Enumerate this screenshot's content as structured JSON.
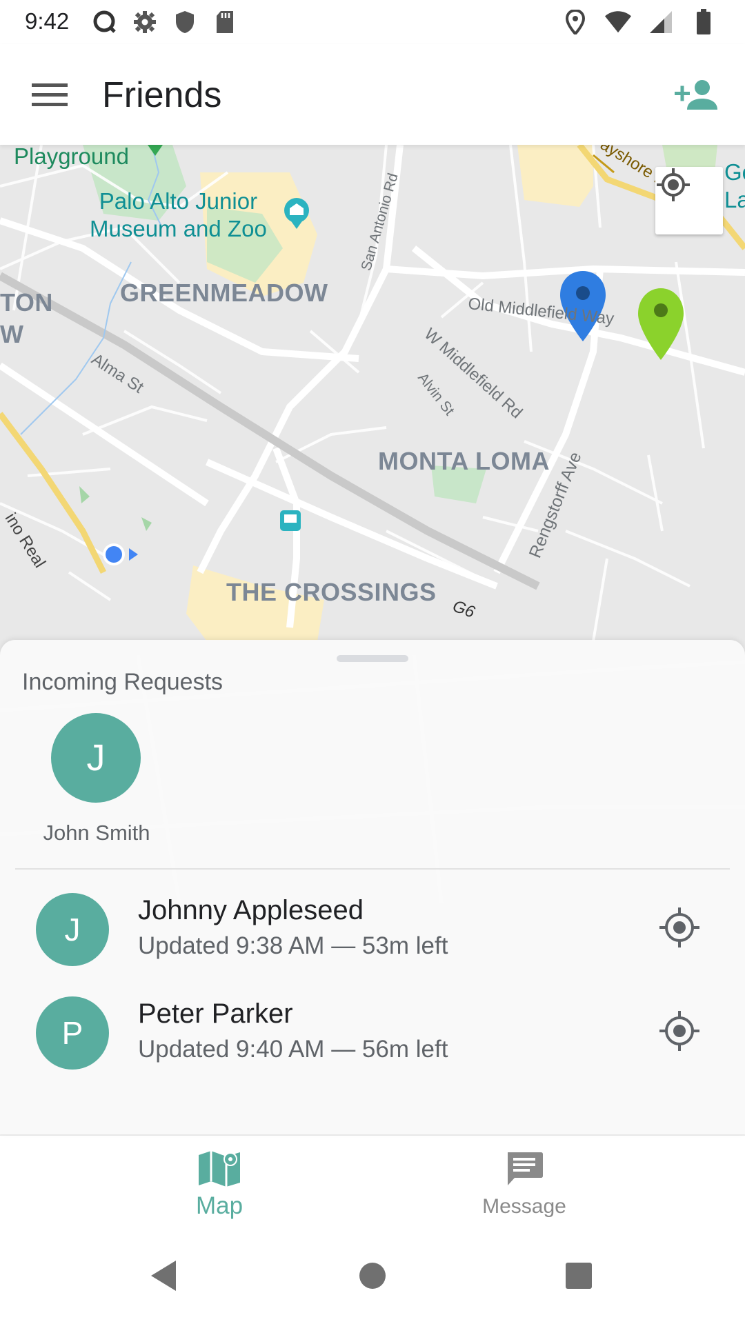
{
  "status_bar": {
    "time": "9:42",
    "left_icons": [
      "notification-circle-icon",
      "settings-gear-icon",
      "shield-icon",
      "sd-card-icon"
    ],
    "right_icons": [
      "location-pin-icon",
      "wifi-icon",
      "cellular-signal-icon",
      "battery-icon"
    ]
  },
  "app_bar": {
    "title": "Friends",
    "menu_icon": "hamburger-menu-icon",
    "action_icon": "person-add-icon"
  },
  "map": {
    "labels": {
      "playground": "Playground",
      "museum": "Palo Alto Junior\nMuseum and Zoo",
      "greenmeadow": "GREENMEADOW",
      "ton": "TON",
      "w": "W",
      "old_middlefield": "Old Middlefield Way",
      "w_middlefield": "W Middlefield Rd",
      "alvin": "Alvin St",
      "alma": "Alma St",
      "san_antonio": "San Antonio Rd",
      "monta_loma": "MONTA LOMA",
      "rengstorff": "Rengstorff Ave",
      "the_crossings": "THE CROSSINGS",
      "g6": "G6",
      "camino_real": "ino Real",
      "bayshore": "ayshore Fwy",
      "gl": "Go\nLa"
    },
    "markers": [
      {
        "name": "blue-location-marker",
        "color": "#2f7de1"
      },
      {
        "name": "green-location-marker",
        "color": "#8bd22c"
      }
    ],
    "my_location_color": "#4285f4"
  },
  "sheet": {
    "section_title": "Incoming Requests",
    "request": {
      "initial": "J",
      "name": "John Smith"
    },
    "friends": [
      {
        "initial": "J",
        "name": "Johnny Appleseed",
        "meta": "Updated 9:38 AM  —  53m left"
      },
      {
        "initial": "P",
        "name": "Peter Parker",
        "meta": "Updated 9:40 AM  —  56m left"
      }
    ],
    "avatar_color": "#59ad9f"
  },
  "bottom_nav": {
    "map_label": "Map",
    "message_label": "Message",
    "active": "Map",
    "accent": "#59ad9f"
  },
  "system_nav": {
    "icons": [
      "back-triangle-icon",
      "home-circle-icon",
      "recents-square-icon"
    ]
  }
}
